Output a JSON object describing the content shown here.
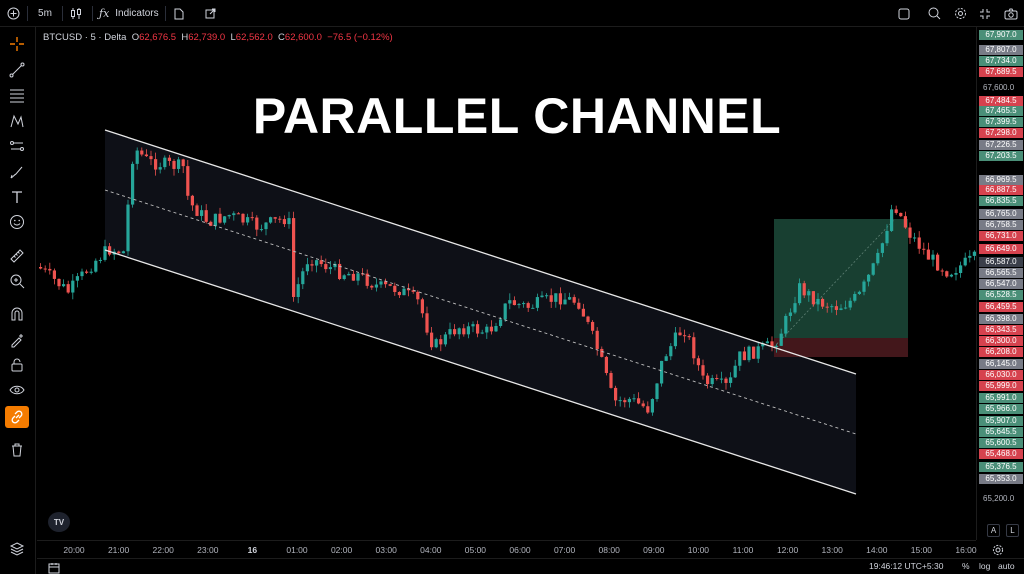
{
  "toolbar": {
    "timeframe": "5m",
    "indicators_label": "Indicators"
  },
  "symbol": {
    "name": "BTCUSD · 5 · Delta",
    "open_label": "O",
    "open": "62,676.5",
    "high_label": "H",
    "high": "62,739.0",
    "low_label": "L",
    "low": "62,562.0",
    "close_label": "C",
    "close": "62,600.0",
    "change": "−76.5 (−0.12%)"
  },
  "overlay_title": "PARALLEL CHANNEL",
  "colors": {
    "up": "#26a69a",
    "down": "#ef5350",
    "green_tag": "#4a8f78",
    "red_tag": "#d6424e",
    "grey_tag": "#787b86",
    "accent": "#f57c00"
  },
  "price_axis": {
    "tags": [
      {
        "text": "67,907.0",
        "kind": "green"
      },
      {
        "text": "67,807.0",
        "kind": "grey"
      },
      {
        "text": "67,734.0",
        "kind": "green"
      },
      {
        "text": "67,689.5",
        "kind": "red"
      },
      {
        "text": "67,600.0",
        "kind": "plain"
      },
      {
        "text": "67,484.5",
        "kind": "red"
      },
      {
        "text": "67,465.5",
        "kind": "green"
      },
      {
        "text": "67,399.5",
        "kind": "green"
      },
      {
        "text": "67,298.0",
        "kind": "red"
      },
      {
        "text": "67,226.5",
        "kind": "grey"
      },
      {
        "text": "67,203.5",
        "kind": "green"
      },
      {
        "text": "66,969.5",
        "kind": "grey"
      },
      {
        "text": "66,887.5",
        "kind": "red"
      },
      {
        "text": "66,835.5",
        "kind": "green"
      },
      {
        "text": "66,765.0",
        "kind": "grey"
      },
      {
        "text": "66,758.5",
        "kind": "grey"
      },
      {
        "text": "66,731.0",
        "kind": "red"
      },
      {
        "text": "66,649.0",
        "kind": "red"
      },
      {
        "text": "66,587.0",
        "kind": "dark"
      },
      {
        "text": "66,565.5",
        "kind": "grey"
      },
      {
        "text": "66,547.0",
        "kind": "grey"
      },
      {
        "text": "66,528.5",
        "kind": "green"
      },
      {
        "text": "66,459.5",
        "kind": "red"
      },
      {
        "text": "66,398.0",
        "kind": "grey"
      },
      {
        "text": "66,343.5",
        "kind": "red"
      },
      {
        "text": "66,300.0",
        "kind": "red"
      },
      {
        "text": "66,208.0",
        "kind": "red"
      },
      {
        "text": "66,145.0",
        "kind": "grey"
      },
      {
        "text": "66,030.0",
        "kind": "red"
      },
      {
        "text": "65,999.0",
        "kind": "red"
      },
      {
        "text": "65,991.0",
        "kind": "green"
      },
      {
        "text": "65,966.0",
        "kind": "green"
      },
      {
        "text": "65,907.0",
        "kind": "green"
      },
      {
        "text": "65,645.5",
        "kind": "green"
      },
      {
        "text": "65,600.5",
        "kind": "green"
      },
      {
        "text": "65,468.0",
        "kind": "red"
      },
      {
        "text": "65,376.5",
        "kind": "green"
      },
      {
        "text": "65,353.0",
        "kind": "grey"
      },
      {
        "text": "65,200.0",
        "kind": "plain"
      }
    ],
    "auto_label": "A",
    "lock_label": "L"
  },
  "time_axis": [
    "20:00",
    "21:00",
    "22:00",
    "23:00",
    "16",
    "01:00",
    "02:00",
    "03:00",
    "04:00",
    "05:00",
    "06:00",
    "07:00",
    "08:00",
    "09:00",
    "10:00",
    "11:00",
    "12:00",
    "13:00",
    "14:00",
    "15:00",
    "16:00"
  ],
  "bottom": {
    "clock": "19:46:12 UTC+5:30",
    "percent": "%",
    "log": "log",
    "auto": "auto"
  },
  "logo_text": "TV"
}
